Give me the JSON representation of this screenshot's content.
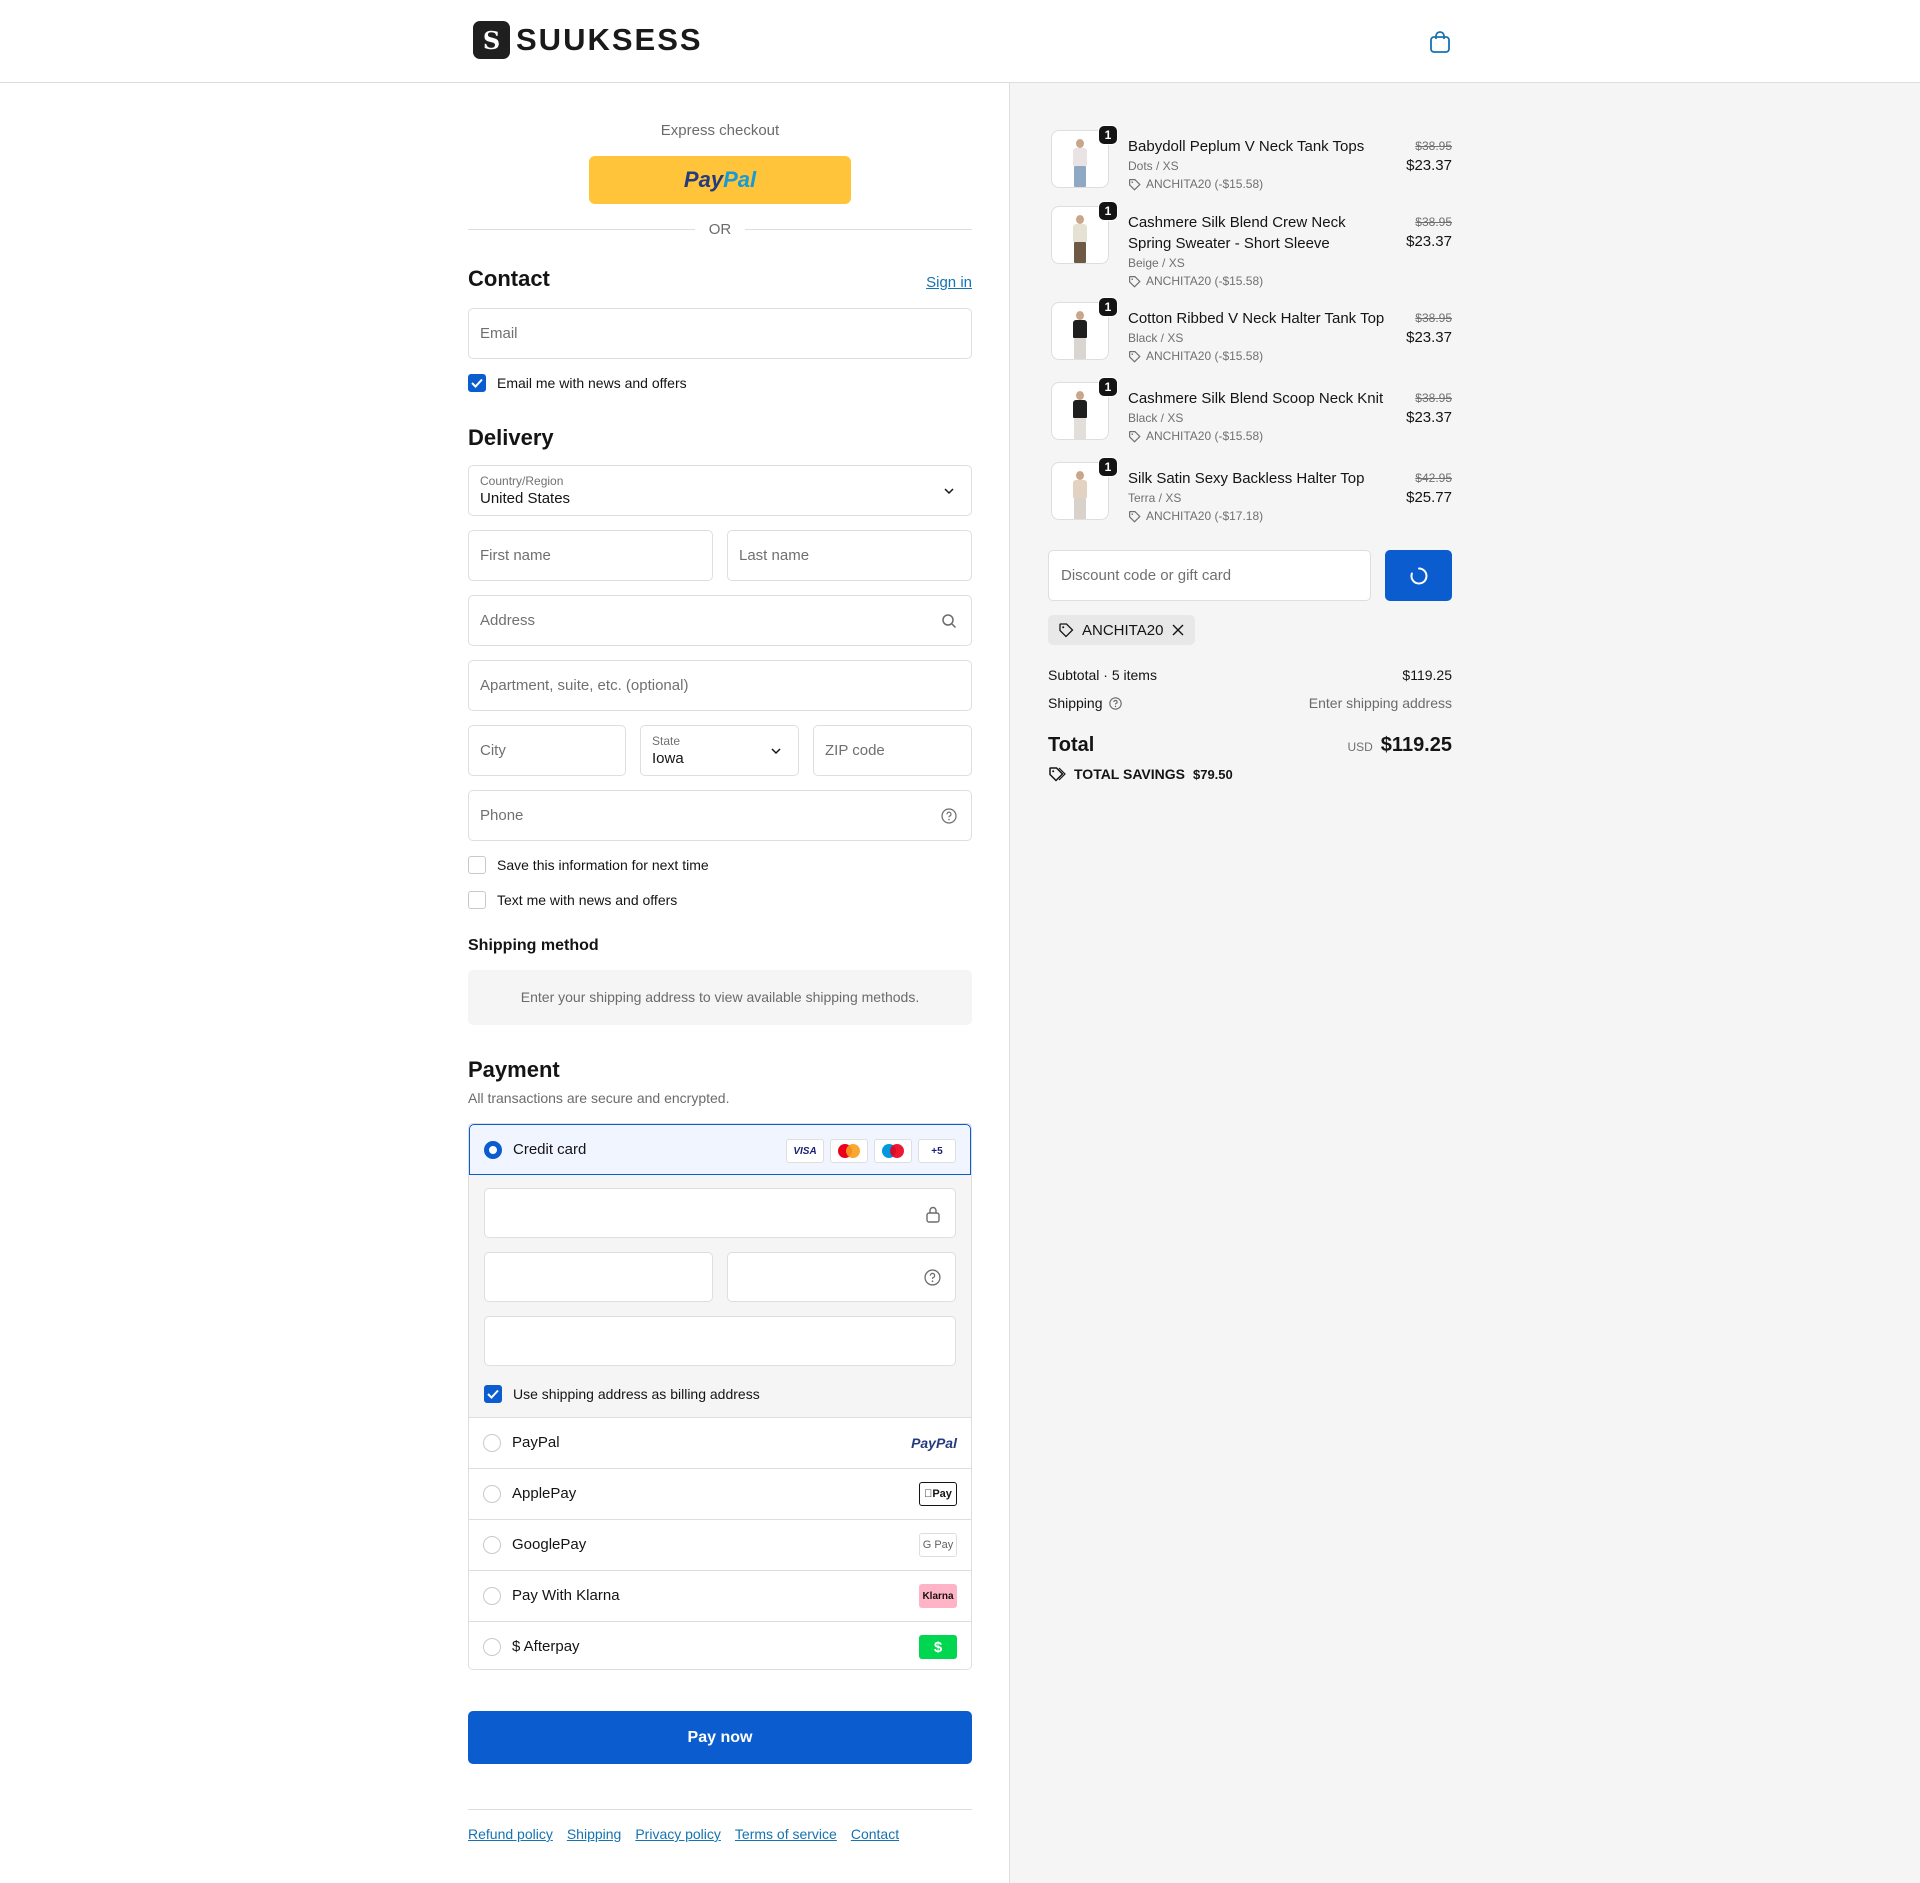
{
  "brand": {
    "name": "SUUKSESS",
    "mark": "S"
  },
  "express": {
    "label": "Express checkout",
    "paypal_a": "Pay",
    "paypal_b": "Pal",
    "or": "OR"
  },
  "contact": {
    "title": "Contact",
    "sign_in": "Sign in",
    "email_placeholder": "Email",
    "news_label": "Email me with news and offers"
  },
  "delivery": {
    "title": "Delivery",
    "country_label": "Country/Region",
    "country_value": "United States",
    "first_name": "First name",
    "last_name": "Last name",
    "address": "Address",
    "apartment": "Apartment, suite, etc. (optional)",
    "city": "City",
    "state_label": "State",
    "state_value": "Iowa",
    "zip": "ZIP code",
    "phone": "Phone",
    "save_info": "Save this information for next time",
    "text_me": "Text me with news and offers"
  },
  "shipping_method": {
    "title": "Shipping method",
    "note": "Enter your shipping address to view available shipping methods."
  },
  "payment": {
    "title": "Payment",
    "subtitle": "All transactions are secure and encrypted.",
    "credit_card": "Credit card",
    "card_logos": [
      "VISA",
      "",
      "",
      "+5"
    ],
    "billing_same": "Use shipping address as billing address",
    "methods": [
      {
        "label": "PayPal",
        "badge": "PayPal"
      },
      {
        "label": "ApplePay",
        "badge": "Pay"
      },
      {
        "label": "GooglePay",
        "badge": "G Pay"
      },
      {
        "label": "Pay With Klarna",
        "badge": "Klarna"
      },
      {
        "label": "$ Afterpay",
        "badge": "$"
      }
    ],
    "pay_now": "Pay now"
  },
  "footer": {
    "links": [
      "Refund policy",
      "Shipping",
      "Privacy policy",
      "Terms of service",
      "Contact"
    ]
  },
  "order": {
    "items": [
      {
        "name": "Babydoll Peplum V Neck Tank Tops",
        "variant": "Dots / XS",
        "discount": "ANCHITA20 (-$15.58)",
        "old_price": "$38.95",
        "price": "$23.37",
        "qty": "1",
        "top_color": "#e9e3e3",
        "legs_color": "#8fa9c4"
      },
      {
        "name": "Cashmere Silk Blend Crew Neck Spring Sweater - Short Sleeve",
        "variant": "Beige / XS",
        "discount": "ANCHITA20 (-$15.58)",
        "old_price": "$38.95",
        "price": "$23.37",
        "qty": "1",
        "top_color": "#e6e2d3",
        "legs_color": "#6e5a44"
      },
      {
        "name": "Cotton Ribbed V Neck Halter Tank Top",
        "variant": "Black / XS",
        "discount": "ANCHITA20 (-$15.58)",
        "old_price": "$38.95",
        "price": "$23.37",
        "qty": "1",
        "top_color": "#1e1e1e",
        "legs_color": "#d9d6d2"
      },
      {
        "name": "Cashmere Silk Blend Scoop Neck Knit",
        "variant": "Black / XS",
        "discount": "ANCHITA20 (-$15.58)",
        "old_price": "$38.95",
        "price": "$23.37",
        "qty": "1",
        "top_color": "#1e1e1e",
        "legs_color": "#e2dfdb"
      },
      {
        "name": "Silk Satin Sexy Backless Halter Top",
        "variant": "Terra / XS",
        "discount": "ANCHITA20 (-$17.18)",
        "old_price": "$42.95",
        "price": "$25.77",
        "qty": "1",
        "top_color": "#e3d2c1",
        "legs_color": "#d8d2cb"
      }
    ],
    "discount_placeholder": "Discount code or gift card",
    "applied_code": "ANCHITA20",
    "subtotal_label": "Subtotal · 5 items",
    "subtotal_value": "$119.25",
    "shipping_label": "Shipping",
    "shipping_value": "Enter shipping address",
    "total_label": "Total",
    "currency": "USD",
    "total_value": "$119.25",
    "savings_label": "TOTAL SAVINGS",
    "savings_value": "$79.50"
  },
  "colors": {
    "accent": "#0b5ccf",
    "paypal_yellow": "#ffc439",
    "link": "#1773b0"
  }
}
